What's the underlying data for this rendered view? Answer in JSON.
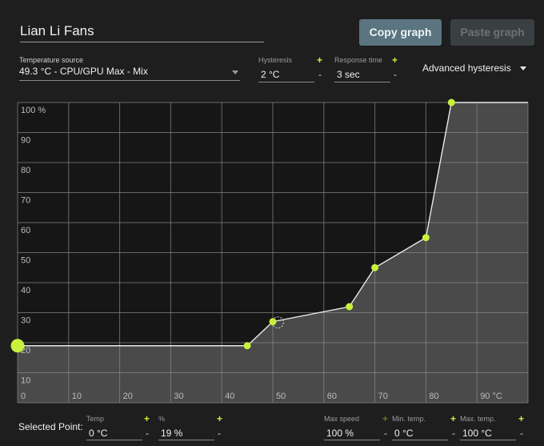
{
  "header": {
    "profile_name": "Lian Li Fans",
    "copy_label": "Copy graph",
    "paste_label": "Paste graph"
  },
  "settings": {
    "temp_source_label": "Temperature source",
    "temp_source_value": "49.3 °C - CPU/GPU Max - Mix",
    "hysteresis_label": "Hysteresis",
    "hysteresis_value": "2 °C",
    "response_label": "Response time",
    "response_value": "3 sec",
    "advanced_label": "Advanced hysteresis",
    "plus": "+",
    "minus": "-"
  },
  "chart_data": {
    "type": "line",
    "x_ticks": [
      "0",
      "10",
      "20",
      "30",
      "40",
      "50",
      "60",
      "70",
      "80",
      "90 °C"
    ],
    "y_ticks": [
      "10",
      "20",
      "30",
      "40",
      "50",
      "60",
      "70",
      "80",
      "90",
      "100 %"
    ],
    "xlim": [
      0,
      100
    ],
    "ylim": [
      0,
      100
    ],
    "grid": true,
    "points": [
      {
        "x": 0,
        "y": 19
      },
      {
        "x": 45,
        "y": 19
      },
      {
        "x": 50,
        "y": 27
      },
      {
        "x": 65,
        "y": 32
      },
      {
        "x": 70,
        "y": 45
      },
      {
        "x": 80,
        "y": 55
      },
      {
        "x": 85,
        "y": 100
      }
    ],
    "selected_index": 0,
    "current_temp": 51,
    "line_end_x": 100,
    "colors": {
      "point": "#c8f03c",
      "line": "#e8e8e8",
      "fill": "#4a4a4a",
      "grid": "#8a8a8a"
    }
  },
  "footer": {
    "selected_label": "Selected Point:",
    "temp_label": "Temp",
    "temp_value": "0 °C",
    "pct_label": "%",
    "pct_value": "19 %",
    "max_speed_label": "Max speed",
    "max_speed_value": "100 %",
    "min_temp_label": "Min. temp.",
    "min_temp_value": "0 °C",
    "max_temp_label": "Max. temp.",
    "max_temp_value": "100 °C",
    "plus": "+",
    "minus": "-"
  }
}
